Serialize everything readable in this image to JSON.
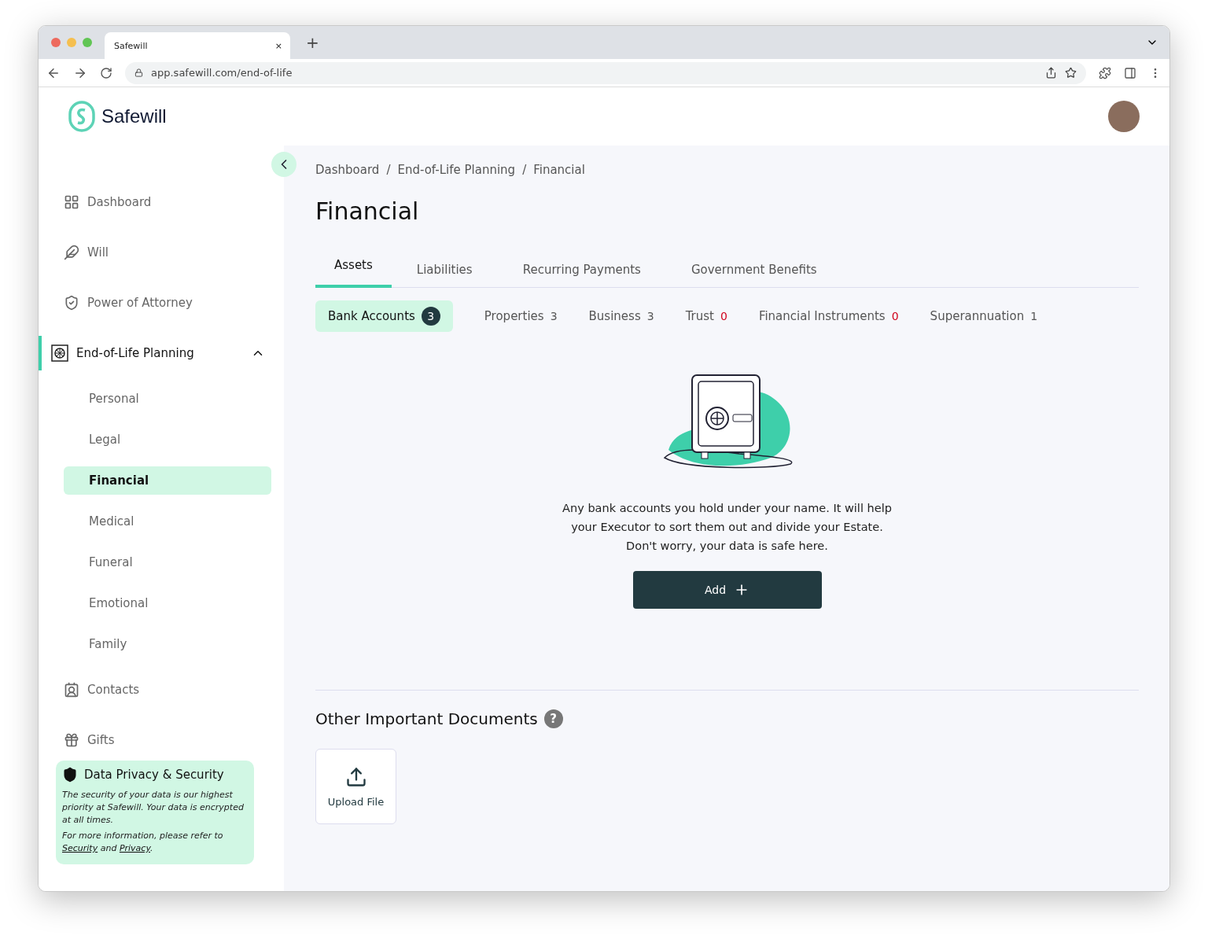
{
  "browser": {
    "tab_title": "Safewill",
    "tab_close": "×",
    "new_tab": "+",
    "url": "app.safewill.com/end-of-life"
  },
  "header": {
    "logo": "Safewill"
  },
  "sidebar": {
    "items": [
      {
        "label": "Dashboard",
        "selected": false
      },
      {
        "label": "Will",
        "selected": false
      },
      {
        "label": "Power of Attorney",
        "selected": false
      },
      {
        "label": "End-of-Life Planning",
        "selected": true,
        "expanded": true,
        "children": [
          {
            "label": "Personal",
            "selected": false
          },
          {
            "label": "Legal",
            "selected": false
          },
          {
            "label": "Financial",
            "selected": true
          },
          {
            "label": "Medical",
            "selected": false
          },
          {
            "label": "Funeral",
            "selected": false
          },
          {
            "label": "Emotional",
            "selected": false
          },
          {
            "label": "Family",
            "selected": false
          }
        ]
      },
      {
        "label": "Contacts",
        "selected": false
      },
      {
        "label": "Gifts",
        "selected": false
      }
    ]
  },
  "privacy": {
    "title": "Data Privacy & Security",
    "body": "The security of your data is our highest priority at Safewill. Your data is encrypted at all times.",
    "note_before": "For more information, please refer to",
    "link_security": "Security",
    "note_between": "and",
    "link_privacy": "Privacy",
    "note_after": "."
  },
  "breadcrumbs": [
    "Dashboard",
    "End-of-Life Planning",
    "Financial"
  ],
  "breadcrumb_separator": "/",
  "title": "Financial",
  "tabs": [
    {
      "label": "Assets",
      "selected": true
    },
    {
      "label": "Liabilities",
      "selected": false
    },
    {
      "label": "Recurring Payments",
      "selected": false
    },
    {
      "label": "Government Benefits",
      "selected": false
    }
  ],
  "subtabs": [
    {
      "label": "Bank Accounts",
      "count": "3",
      "selected": true,
      "color": "#ffffff"
    },
    {
      "label": "Properties",
      "count": "3",
      "selected": false,
      "color": "#555555"
    },
    {
      "label": "Business",
      "count": "3",
      "selected": false,
      "color": "#555555"
    },
    {
      "label": "Trust",
      "count": "0",
      "selected": false,
      "color": "#d0021b"
    },
    {
      "label": "Financial Instruments",
      "count": "0",
      "selected": false,
      "color": "#d0021b"
    },
    {
      "label": "Superannuation",
      "count": "1",
      "selected": false,
      "color": "#555555"
    }
  ],
  "empty_state": {
    "text": "Any bank accounts you hold under your name. It will help\nyour Executor to sort them out and divide your Estate.\nDon't worry, your data is safe here.",
    "button": "Add"
  },
  "documents": {
    "title": "Other Important Documents",
    "help": "?",
    "upload": "Upload File"
  }
}
